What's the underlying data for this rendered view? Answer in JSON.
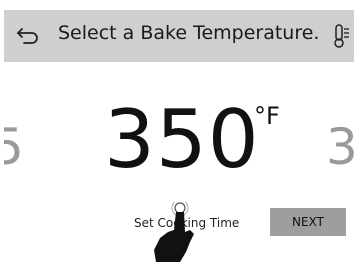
{
  "header": {
    "back_icon": "back-arrow-icon",
    "title": "Select a Bake Temperature.",
    "settings_icon": "thermometer-icon"
  },
  "temperature": {
    "previous": "5",
    "current": "350",
    "unit": "°F",
    "next": "3"
  },
  "footer": {
    "set_cooking_time": "Set Cooking Time",
    "next_label": "NEXT"
  },
  "colors": {
    "header_bg": "#cfcfcf",
    "button_bg": "#9e9e9e",
    "muted_text": "#9a9a9a"
  }
}
